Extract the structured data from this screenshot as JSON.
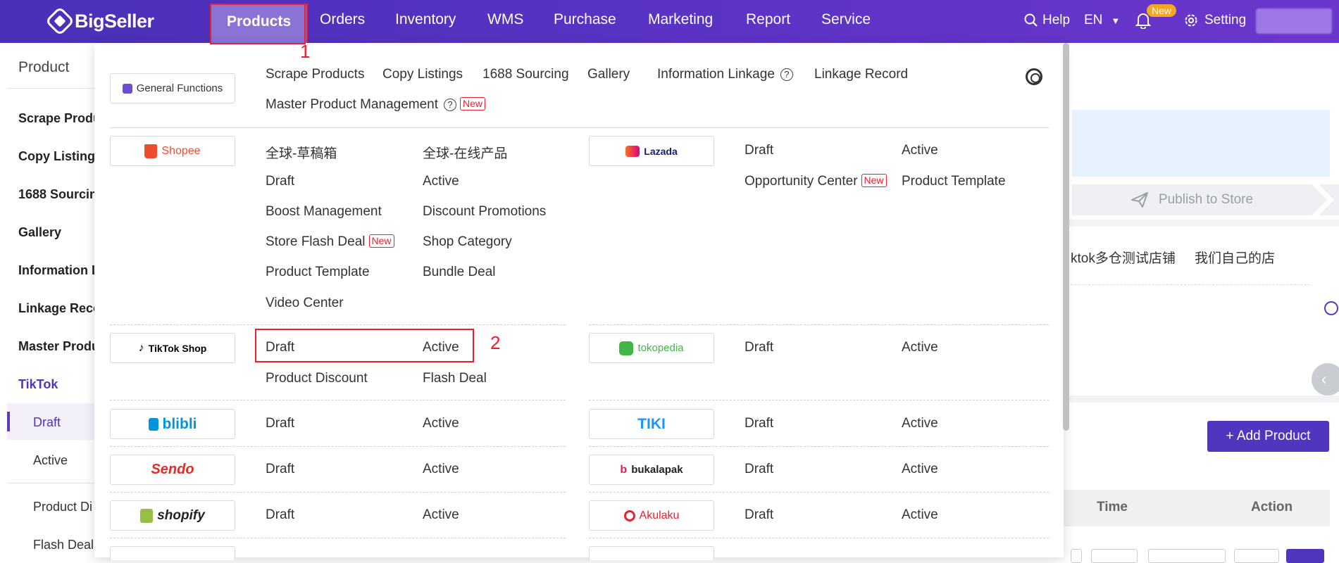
{
  "brand": {
    "name": "BigSeller"
  },
  "nav": {
    "items": [
      "Products",
      "Orders",
      "Inventory",
      "WMS",
      "Purchase",
      "Marketing",
      "Report",
      "Service"
    ],
    "help": "Help",
    "lang": "EN",
    "new_badge": "New",
    "setting": "Setting"
  },
  "sidebar": {
    "title": "Product",
    "items": [
      "Scrape Produ",
      "Copy Listings",
      "1688 Sourcin",
      "Gallery",
      "Information L",
      "Linkage Reco",
      "Master Produ"
    ],
    "group": "TikTok",
    "sub_items": [
      "Draft",
      "Active"
    ],
    "sub_items2": [
      "Product Di",
      "Flash Deal"
    ]
  },
  "background": {
    "publish": "Publish to Store",
    "store_tabs": [
      "ktok多仓测试店铺",
      "我们自己的店"
    ],
    "add_product": "+ Add Product",
    "table_headers": [
      "Time",
      "Action"
    ]
  },
  "menu": {
    "general": {
      "label": "General Functions",
      "links": [
        "Scrape Products",
        "Copy Listings",
        "1688 Sourcing",
        "Gallery",
        "Information Linkage",
        "Linkage Record",
        "Master Product Management"
      ],
      "help_mark": "?",
      "new_tag": "New"
    },
    "shopee": {
      "logo": "Shopee",
      "links": [
        "全球-草稿箱",
        "全球-在线产品",
        "Draft",
        "Active",
        "Boost Management",
        "Discount Promotions",
        "Store Flash Deal",
        "Shop Category",
        "Product Template",
        "Bundle Deal",
        "Video Center"
      ]
    },
    "lazada": {
      "logo": "Lazada",
      "links": [
        "Draft",
        "Active",
        "Opportunity Center",
        "Product Template"
      ]
    },
    "tiktok": {
      "logo": "TikTok Shop",
      "links": [
        "Draft",
        "Active",
        "Product Discount",
        "Flash Deal"
      ]
    },
    "tokopedia": {
      "logo": "tokopedia",
      "links": [
        "Draft",
        "Active"
      ]
    },
    "blibli": {
      "logo": "blibli",
      "links": [
        "Draft",
        "Active"
      ]
    },
    "tiki": {
      "logo": "TIKI",
      "links": [
        "Draft",
        "Active"
      ]
    },
    "sendo": {
      "logo": "Sendo",
      "links": [
        "Draft",
        "Active"
      ]
    },
    "bukalapak": {
      "logo": "bukalapak",
      "links": [
        "Draft",
        "Active"
      ]
    },
    "shopify": {
      "logo": "shopify",
      "links": [
        "Draft",
        "Active"
      ]
    },
    "akulaku": {
      "logo": "Akulaku",
      "links": [
        "Draft",
        "Active"
      ]
    }
  },
  "annotations": [
    "1",
    "2"
  ],
  "colors": {
    "nav_bg": "#5a33c4",
    "accent": "#5035bf",
    "annotation": "#e8212e"
  }
}
